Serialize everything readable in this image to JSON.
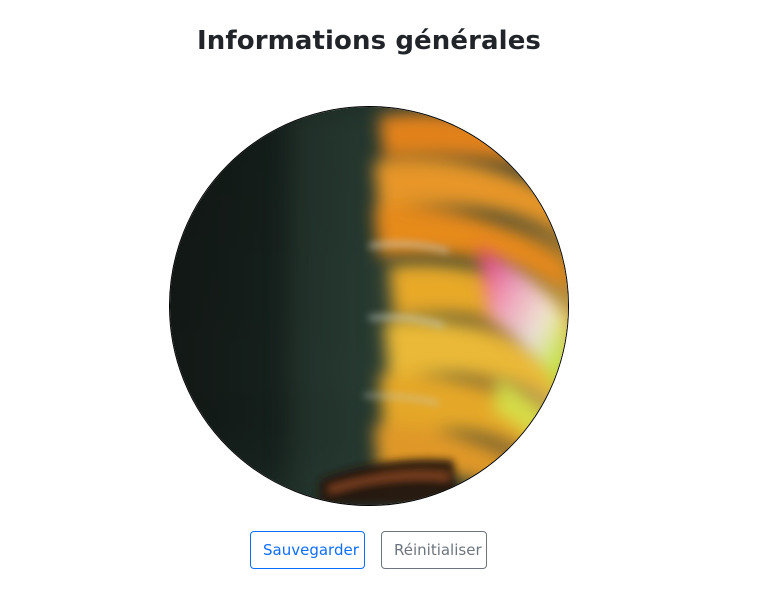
{
  "page": {
    "title": "Informations générales"
  },
  "avatar": {
    "image_alt": "abstract colorful motion-blurred photo"
  },
  "actions": {
    "save_label": "Sauvegarder",
    "reset_label": "Réinitialiser"
  },
  "colors": {
    "primary": "#0d6efd",
    "secondary": "#6c757d",
    "title_text": "#212529",
    "avatar_border": "#000000"
  }
}
